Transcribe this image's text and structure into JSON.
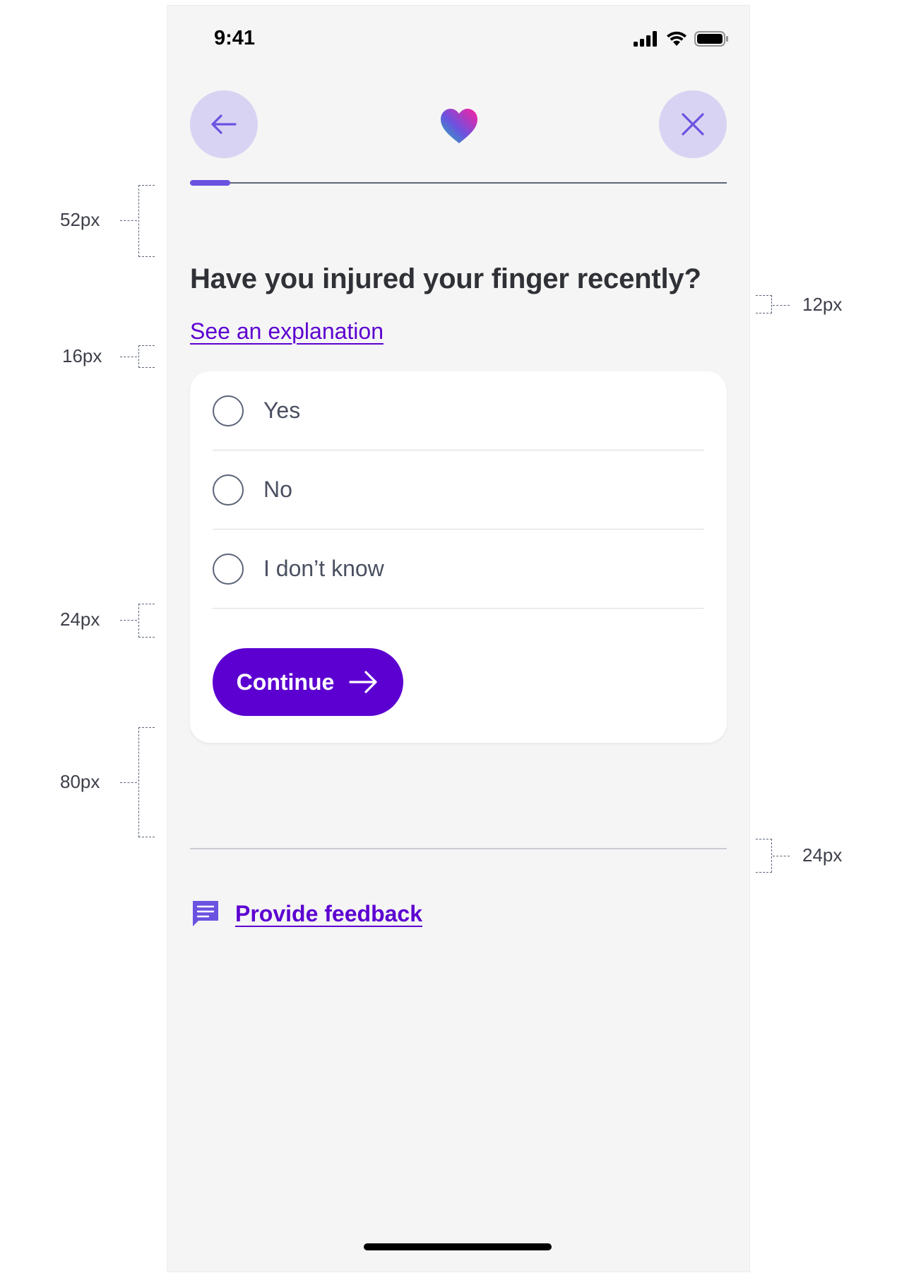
{
  "status_bar": {
    "time": "9:41"
  },
  "header": {
    "back_icon": "arrow-left-icon",
    "logo_icon": "heart-logo-icon",
    "close_icon": "close-icon",
    "progress": 0.075
  },
  "question": {
    "title": "Have you injured your finger recently?",
    "explanation_link": "See an explanation"
  },
  "options": [
    {
      "label": "Yes"
    },
    {
      "label": "No"
    },
    {
      "label": "I don’t know"
    }
  ],
  "continue_button": {
    "label": "Continue"
  },
  "feedback": {
    "label": "Provide feedback",
    "icon": "feedback-icon"
  },
  "spacing_annotations": {
    "left": [
      "52px",
      "16px",
      "24px",
      "80px"
    ],
    "right": [
      "12px",
      "24px"
    ]
  },
  "colors": {
    "primary": "#5c00d1",
    "accent_light": "#d9d3f3",
    "progress": "#6b52e0",
    "background": "#f5f5f5"
  }
}
